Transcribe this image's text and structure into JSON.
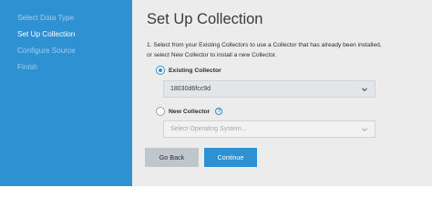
{
  "sidebar": {
    "steps": [
      {
        "label": "Select Data Type",
        "active": false
      },
      {
        "label": "Set Up Collection",
        "active": true
      },
      {
        "label": "Configure Source",
        "active": false
      },
      {
        "label": "Finish",
        "active": false
      }
    ]
  },
  "main": {
    "title": "Set Up Collection",
    "instruction_line1": "1. Select from your Existing Collectors to use a Collector that has already been installed,",
    "instruction_line2": "or select New Collector to install a new Collector.",
    "existing_collector": {
      "label": "Existing Collector",
      "selected": true,
      "select_value": "18030d6fcc9d"
    },
    "new_collector": {
      "label": "New Collector",
      "help_icon": "help-icon",
      "selected": false,
      "select_placeholder": "Select Operating System..."
    },
    "buttons": {
      "back": "Go Back",
      "continue": "Continue"
    }
  },
  "colors": {
    "sidebar": "#2e91d2",
    "accent": "#2e91d2",
    "main_bg": "#ececec"
  }
}
